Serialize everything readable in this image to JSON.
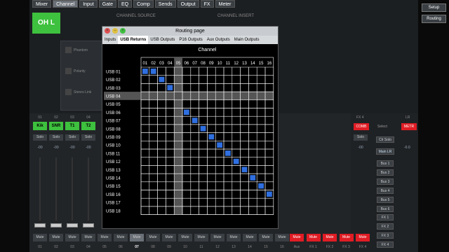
{
  "top_nav": {
    "tabs": [
      "Mixer",
      "Channel",
      "Input",
      "Gate",
      "EQ",
      "Comp",
      "Sends",
      "Output",
      "FX",
      "Meter"
    ],
    "active": "Channel"
  },
  "channel_name": "OH L",
  "sections": {
    "source": "CHANNEL SOURCE",
    "insert": "CHANNEL INSERT"
  },
  "background_options": [
    {
      "label": "Phantom"
    },
    {
      "label": "Polarity"
    },
    {
      "label": "Stereo Link"
    }
  ],
  "right_buttons": {
    "setup": "Setup",
    "routing": "Routing"
  },
  "routing_window": {
    "title": "Routing page",
    "tabs": [
      "Inputs",
      "USB Returns",
      "USB Outputs",
      "P16 Outputs",
      "Aux Outputs",
      "Main Outputs"
    ],
    "active_tab": "USB Returns",
    "column_header": "Channel",
    "columns": [
      "01",
      "02",
      "03",
      "04",
      "05",
      "06",
      "07",
      "08",
      "09",
      "10",
      "11",
      "12",
      "13",
      "14",
      "15",
      "16"
    ],
    "rows": [
      "USB 01",
      "USB 02",
      "USB 03",
      "USB 04",
      "USB 05",
      "USB 06",
      "USB 07",
      "USB 08",
      "USB 09",
      "USB 10",
      "USB 11",
      "USB 12",
      "USB 13",
      "USB 14",
      "USB 15",
      "USB 16",
      "USB 17",
      "USB 18"
    ],
    "highlighted_row": "USB 04",
    "highlighted_column": "05",
    "routes": [
      {
        "row": "USB 01",
        "channel": "01"
      },
      {
        "row": "USB 01",
        "channel": "02"
      },
      {
        "row": "USB 02",
        "channel": "03"
      },
      {
        "row": "USB 03",
        "channel": "04"
      },
      {
        "row": "USB 06",
        "channel": "06"
      },
      {
        "row": "USB 07",
        "channel": "07"
      },
      {
        "row": "USB 08",
        "channel": "08"
      },
      {
        "row": "USB 09",
        "channel": "09"
      },
      {
        "row": "USB 10",
        "channel": "10"
      },
      {
        "row": "USB 11",
        "channel": "11"
      },
      {
        "row": "USB 12",
        "channel": "12"
      },
      {
        "row": "USB 13",
        "channel": "13"
      },
      {
        "row": "USB 14",
        "channel": "14"
      },
      {
        "row": "USB 15",
        "channel": "15"
      },
      {
        "row": "USB 16",
        "channel": "16"
      }
    ],
    "route_color": "#2f6fe0"
  },
  "strip": {
    "top_numbers": [
      "01",
      "02",
      "03",
      "04"
    ],
    "channel_labels": [
      "Kik",
      "SNR",
      "T1",
      "T2"
    ],
    "solo_label": "Solo",
    "db_value": "-00",
    "mute_label": "Mute",
    "bottom_labels": [
      "01",
      "02",
      "03",
      "04",
      "05",
      "06",
      "07",
      "08",
      "09",
      "10",
      "11",
      "12",
      "13",
      "14",
      "15",
      "16"
    ],
    "fx_bottom": [
      "Aux",
      "FX 1",
      "FX 2",
      "FX 3",
      "FX 4"
    ],
    "top_fx": "FX 4",
    "top_lr": "LR"
  },
  "right_section": {
    "comb": "COMB",
    "select": "Select",
    "metr": "METR",
    "clr_solo": "Clr Solo",
    "main_lr": "Main LR",
    "db": "-0.0",
    "bus_buttons": [
      "Bus 1",
      "Bus 2",
      "Bus 3",
      "Bus 4",
      "Bus 5",
      "Bus 6",
      "FX 1",
      "FX 2",
      "FX 3",
      "FX 4"
    ]
  },
  "colors": {
    "green": "#3ec13e",
    "red": "#e01c24",
    "blue": "#2f6fe0"
  }
}
